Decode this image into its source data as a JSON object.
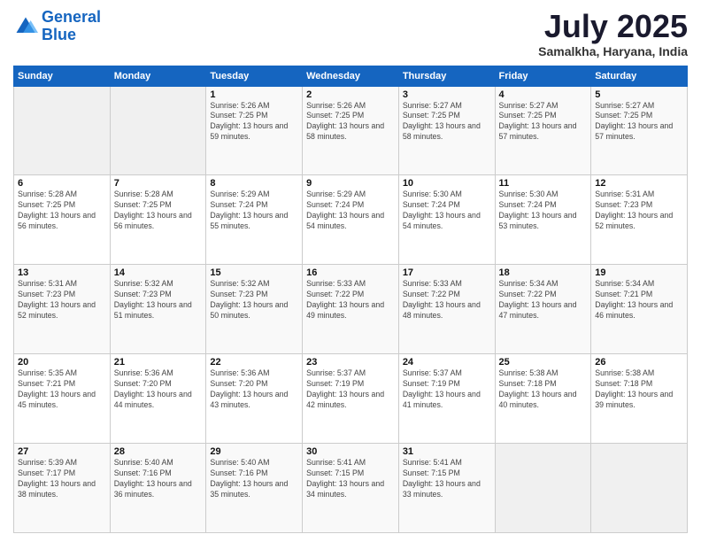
{
  "header": {
    "logo_line1": "General",
    "logo_line2": "Blue",
    "month": "July 2025",
    "location": "Samalkha, Haryana, India"
  },
  "weekdays": [
    "Sunday",
    "Monday",
    "Tuesday",
    "Wednesday",
    "Thursday",
    "Friday",
    "Saturday"
  ],
  "weeks": [
    [
      {
        "day": "",
        "info": ""
      },
      {
        "day": "",
        "info": ""
      },
      {
        "day": "1",
        "info": "Sunrise: 5:26 AM\nSunset: 7:25 PM\nDaylight: 13 hours and 59 minutes."
      },
      {
        "day": "2",
        "info": "Sunrise: 5:26 AM\nSunset: 7:25 PM\nDaylight: 13 hours and 58 minutes."
      },
      {
        "day": "3",
        "info": "Sunrise: 5:27 AM\nSunset: 7:25 PM\nDaylight: 13 hours and 58 minutes."
      },
      {
        "day": "4",
        "info": "Sunrise: 5:27 AM\nSunset: 7:25 PM\nDaylight: 13 hours and 57 minutes."
      },
      {
        "day": "5",
        "info": "Sunrise: 5:27 AM\nSunset: 7:25 PM\nDaylight: 13 hours and 57 minutes."
      }
    ],
    [
      {
        "day": "6",
        "info": "Sunrise: 5:28 AM\nSunset: 7:25 PM\nDaylight: 13 hours and 56 minutes."
      },
      {
        "day": "7",
        "info": "Sunrise: 5:28 AM\nSunset: 7:25 PM\nDaylight: 13 hours and 56 minutes."
      },
      {
        "day": "8",
        "info": "Sunrise: 5:29 AM\nSunset: 7:24 PM\nDaylight: 13 hours and 55 minutes."
      },
      {
        "day": "9",
        "info": "Sunrise: 5:29 AM\nSunset: 7:24 PM\nDaylight: 13 hours and 54 minutes."
      },
      {
        "day": "10",
        "info": "Sunrise: 5:30 AM\nSunset: 7:24 PM\nDaylight: 13 hours and 54 minutes."
      },
      {
        "day": "11",
        "info": "Sunrise: 5:30 AM\nSunset: 7:24 PM\nDaylight: 13 hours and 53 minutes."
      },
      {
        "day": "12",
        "info": "Sunrise: 5:31 AM\nSunset: 7:23 PM\nDaylight: 13 hours and 52 minutes."
      }
    ],
    [
      {
        "day": "13",
        "info": "Sunrise: 5:31 AM\nSunset: 7:23 PM\nDaylight: 13 hours and 52 minutes."
      },
      {
        "day": "14",
        "info": "Sunrise: 5:32 AM\nSunset: 7:23 PM\nDaylight: 13 hours and 51 minutes."
      },
      {
        "day": "15",
        "info": "Sunrise: 5:32 AM\nSunset: 7:23 PM\nDaylight: 13 hours and 50 minutes."
      },
      {
        "day": "16",
        "info": "Sunrise: 5:33 AM\nSunset: 7:22 PM\nDaylight: 13 hours and 49 minutes."
      },
      {
        "day": "17",
        "info": "Sunrise: 5:33 AM\nSunset: 7:22 PM\nDaylight: 13 hours and 48 minutes."
      },
      {
        "day": "18",
        "info": "Sunrise: 5:34 AM\nSunset: 7:22 PM\nDaylight: 13 hours and 47 minutes."
      },
      {
        "day": "19",
        "info": "Sunrise: 5:34 AM\nSunset: 7:21 PM\nDaylight: 13 hours and 46 minutes."
      }
    ],
    [
      {
        "day": "20",
        "info": "Sunrise: 5:35 AM\nSunset: 7:21 PM\nDaylight: 13 hours and 45 minutes."
      },
      {
        "day": "21",
        "info": "Sunrise: 5:36 AM\nSunset: 7:20 PM\nDaylight: 13 hours and 44 minutes."
      },
      {
        "day": "22",
        "info": "Sunrise: 5:36 AM\nSunset: 7:20 PM\nDaylight: 13 hours and 43 minutes."
      },
      {
        "day": "23",
        "info": "Sunrise: 5:37 AM\nSunset: 7:19 PM\nDaylight: 13 hours and 42 minutes."
      },
      {
        "day": "24",
        "info": "Sunrise: 5:37 AM\nSunset: 7:19 PM\nDaylight: 13 hours and 41 minutes."
      },
      {
        "day": "25",
        "info": "Sunrise: 5:38 AM\nSunset: 7:18 PM\nDaylight: 13 hours and 40 minutes."
      },
      {
        "day": "26",
        "info": "Sunrise: 5:38 AM\nSunset: 7:18 PM\nDaylight: 13 hours and 39 minutes."
      }
    ],
    [
      {
        "day": "27",
        "info": "Sunrise: 5:39 AM\nSunset: 7:17 PM\nDaylight: 13 hours and 38 minutes."
      },
      {
        "day": "28",
        "info": "Sunrise: 5:40 AM\nSunset: 7:16 PM\nDaylight: 13 hours and 36 minutes."
      },
      {
        "day": "29",
        "info": "Sunrise: 5:40 AM\nSunset: 7:16 PM\nDaylight: 13 hours and 35 minutes."
      },
      {
        "day": "30",
        "info": "Sunrise: 5:41 AM\nSunset: 7:15 PM\nDaylight: 13 hours and 34 minutes."
      },
      {
        "day": "31",
        "info": "Sunrise: 5:41 AM\nSunset: 7:15 PM\nDaylight: 13 hours and 33 minutes."
      },
      {
        "day": "",
        "info": ""
      },
      {
        "day": "",
        "info": ""
      }
    ]
  ]
}
